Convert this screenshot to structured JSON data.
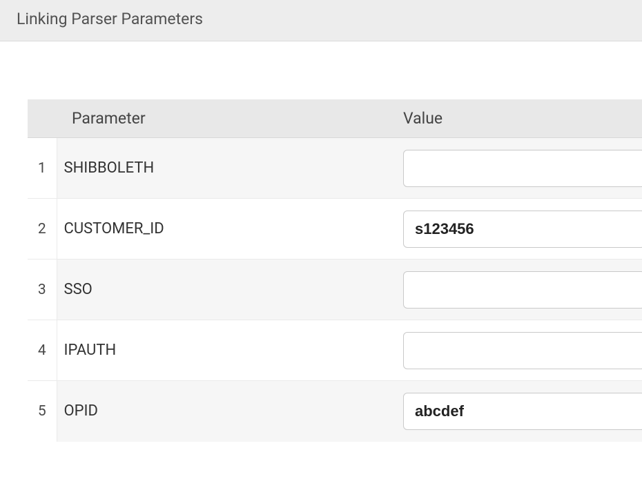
{
  "panel": {
    "title": "Linking Parser Parameters"
  },
  "table": {
    "headers": {
      "parameter": "Parameter",
      "value": "Value"
    },
    "rows": [
      {
        "num": "1",
        "param": "SHIBBOLETH",
        "value": ""
      },
      {
        "num": "2",
        "param": "CUSTOMER_ID",
        "value": "s123456"
      },
      {
        "num": "3",
        "param": "SSO",
        "value": ""
      },
      {
        "num": "4",
        "param": "IPAUTH",
        "value": ""
      },
      {
        "num": "5",
        "param": "OPID",
        "value": "abcdef"
      }
    ]
  }
}
